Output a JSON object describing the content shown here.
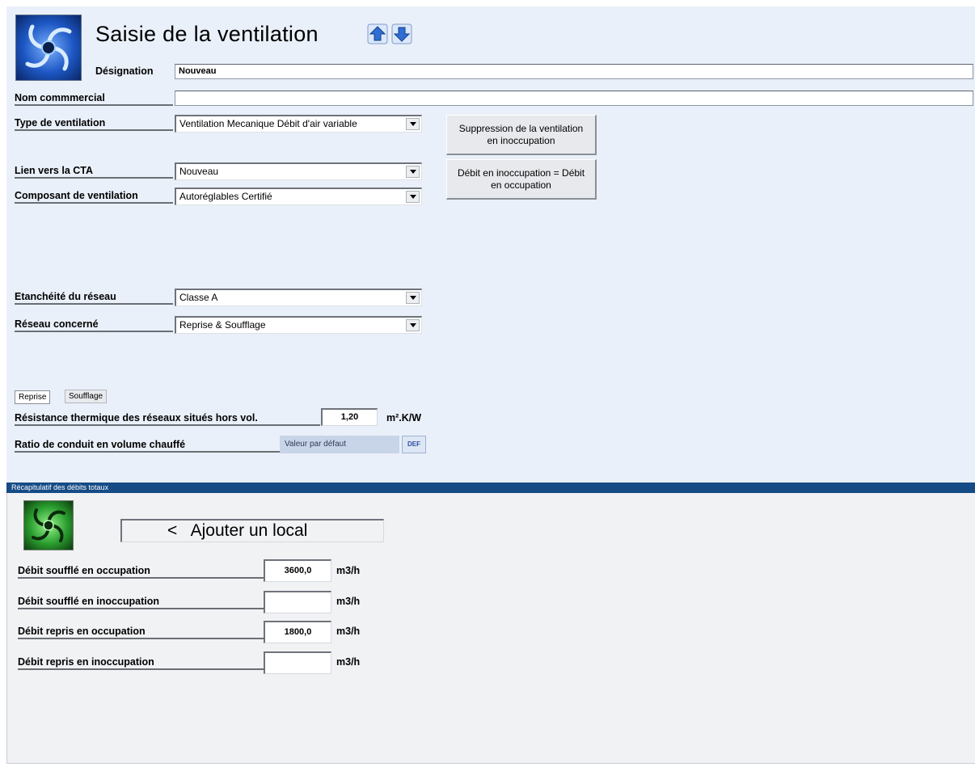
{
  "header": {
    "title": "Saisie de la ventilation",
    "nav_up_icon": "arrow-up-icon",
    "nav_down_icon": "arrow-down-icon",
    "logo_icon": "fan-icon"
  },
  "form": {
    "designation": {
      "label": "Désignation",
      "value": "Nouveau"
    },
    "nom_commercial": {
      "label": "Nom commmercial",
      "value": ""
    },
    "type_ventilation": {
      "label": "Type de ventilation",
      "value": "Ventilation Mecanique Débit d'air variable"
    },
    "lien_cta": {
      "label": "Lien vers la CTA",
      "value": "Nouveau"
    },
    "composant": {
      "label": "Composant de ventilation",
      "value": "Autoréglables Certifié"
    },
    "etancheite": {
      "label": "Etanchéité du réseau",
      "value": "Classe A"
    },
    "reseau": {
      "label": "Réseau concerné",
      "value": "Reprise & Soufflage"
    }
  },
  "buttons": {
    "suppression": "Suppression de la ventilation en inoccupation",
    "debit_equal": "Débit en inoccupation = Débit en occupation"
  },
  "tabs": [
    {
      "label": "Reprise",
      "active": true
    },
    {
      "label": "Soufflage",
      "active": false
    }
  ],
  "thermal": {
    "label": "Résistance thermique des réseaux situés hors vol.",
    "value": "1,20",
    "unit": "m².K/W"
  },
  "ratio": {
    "label": "Ratio de conduit en volume chauffé",
    "value": "Valeur par défaut",
    "def_button": "DEF"
  },
  "recap": {
    "title": "Récapitulatif des débits totaux",
    "add_local": "<   Ajouter un local",
    "logo_icon": "fan-green-icon",
    "rows": [
      {
        "label": "Débit soufflé en occupation",
        "value": "3600,0",
        "unit": "m3/h"
      },
      {
        "label": "Débit soufflé en inoccupation",
        "value": "",
        "unit": "m3/h"
      },
      {
        "label": "Débit repris en occupation",
        "value": "1800,0",
        "unit": "m3/h"
      },
      {
        "label": "Débit repris en inoccupation",
        "value": "",
        "unit": "m3/h"
      }
    ]
  },
  "colors": {
    "panel_bg": "#eaf0f9",
    "recap_bar": "#164b86",
    "bottom_bg": "#f1f2f4"
  }
}
